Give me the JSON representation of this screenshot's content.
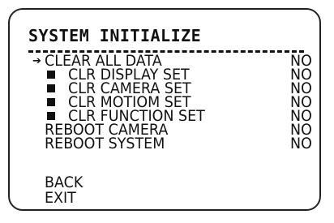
{
  "title": "SYSTEM INITIALIZE",
  "cursor_glyph": "➔",
  "menu": [
    {
      "label": "CLEAR ALL DATA",
      "value": "NO",
      "selected": true,
      "sub": false
    },
    {
      "label": "CLR DISPLAY SET",
      "value": "NO",
      "selected": false,
      "sub": true
    },
    {
      "label": "CLR CAMERA SET",
      "value": "NO",
      "selected": false,
      "sub": true
    },
    {
      "label": "CLR MOTIOM SET",
      "value": "NO",
      "selected": false,
      "sub": true
    },
    {
      "label": "CLR FUNCTION SET",
      "value": "NO",
      "selected": false,
      "sub": true
    },
    {
      "label": "REBOOT CAMERA",
      "value": "NO",
      "selected": false,
      "sub": false
    },
    {
      "label": "REBOOT SYSTEM",
      "value": "NO",
      "selected": false,
      "sub": false
    }
  ],
  "footer": [
    {
      "label": "BACK"
    },
    {
      "label": "EXIT"
    }
  ]
}
